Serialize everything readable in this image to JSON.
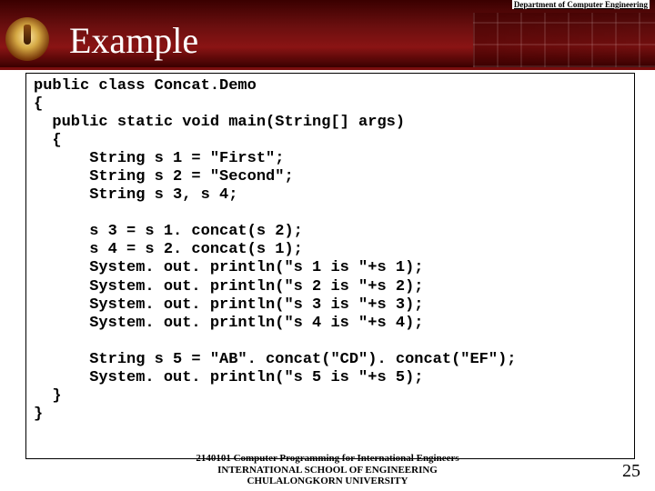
{
  "header": {
    "dept": "Department of Computer Engineering",
    "title": "Example"
  },
  "code": "public class Concat.Demo\n{\n  public static void main(String[] args)\n  {\n      String s 1 = \"First\";\n      String s 2 = \"Second\";\n      String s 3, s 4;\n\n      s 3 = s 1. concat(s 2);\n      s 4 = s 2. concat(s 1);\n      System. out. println(\"s 1 is \"+s 1);\n      System. out. println(\"s 2 is \"+s 2);\n      System. out. println(\"s 3 is \"+s 3);\n      System. out. println(\"s 4 is \"+s 4);\n\n      String s 5 = \"AB\". concat(\"CD\"). concat(\"EF\");\n      System. out. println(\"s 5 is \"+s 5);\n  }\n}",
  "footer": {
    "line1": "2140101 Computer Programming for International Engineers",
    "line2": "INTERNATIONAL SCHOOL OF ENGINEERING",
    "line3": "CHULALONGKORN UNIVERSITY"
  },
  "page": "25"
}
